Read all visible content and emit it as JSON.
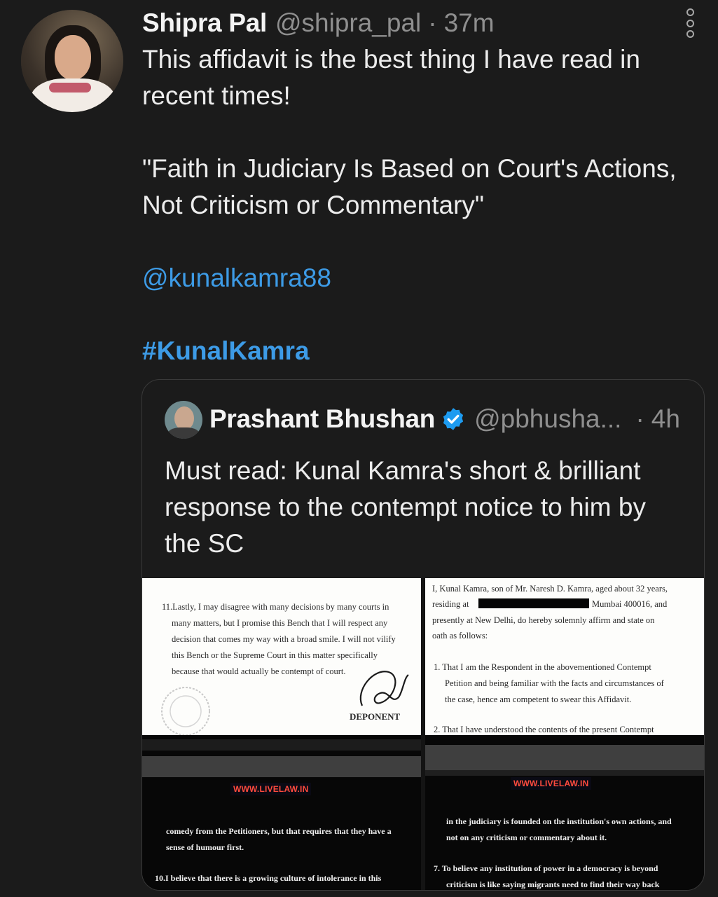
{
  "tweet": {
    "author_name": "Shipra Pal",
    "handle": "@shipra_pal",
    "separator": "·",
    "time": "37m",
    "text_lines": [
      "This affidavit is the best thing I have read in",
      "recent times!",
      "\"Faith in Judiciary Is Based on Court's Actions,",
      "Not Criticism or Commentary\""
    ],
    "mention": "@kunalkamra88",
    "hashtag": "#KunalKamra",
    "more_icon": "more-vertical-icon"
  },
  "quoted_tweet": {
    "author_name": "Prashant Bhushan",
    "verified_icon": "verified-badge-icon",
    "handle": "@pbhusha...",
    "separator": "·",
    "time": "4h",
    "text_lines": [
      "Must read: Kunal Kamra's short & brilliant",
      "response to the contempt notice to him by",
      "the SC"
    ],
    "images": {
      "top_left": {
        "lines": [
          "11.Lastly, I may disagree with many decisions by many courts in",
          "many matters, but I promise this Bench that I will respect any",
          "decision that comes my way with a broad smile. I will not vilify",
          "this Bench or the Supreme Court in this matter specifically",
          "because that would actually be contempt of court."
        ],
        "deponent": "DEPONENT"
      },
      "top_right": {
        "lines": [
          "I, Kunal Kamra, son of Mr. Naresh D. Kamra, aged about 32 years,",
          "residing at",
          "Mumbai 400016, and",
          "presently at New Delhi, do hereby solemnly affirm and state on",
          "oath as follows:",
          "1.  That I am the Respondent in the abovementioned Contempt",
          "Petition and being familiar with the facts and circumstances of",
          "the case, hence am competent to swear this Affidavit.",
          "2.  That I have understood the contents of the present Contempt"
        ]
      },
      "bottom_left": {
        "banner": "WWW.LIVELAW.IN",
        "lines": [
          "comedy from the Petitioners, but that requires that they have a",
          "sense of humour first.",
          "10.I believe that there is a growing culture of intolerance in this"
        ]
      },
      "bottom_right": {
        "banner": "WWW.LIVELAW.IN",
        "lines": [
          "in the judiciary is founded on the institution's own actions, and",
          "not on any criticism or commentary about it.",
          "7.  To believe any institution of power in a democracy is beyond",
          "criticism is like saying migrants need to find their way back"
        ]
      }
    }
  },
  "colors": {
    "background": "#1b1b1b",
    "link": "#3d9be6",
    "muted": "#8f8f8f",
    "verified": "#1d9bf0"
  }
}
